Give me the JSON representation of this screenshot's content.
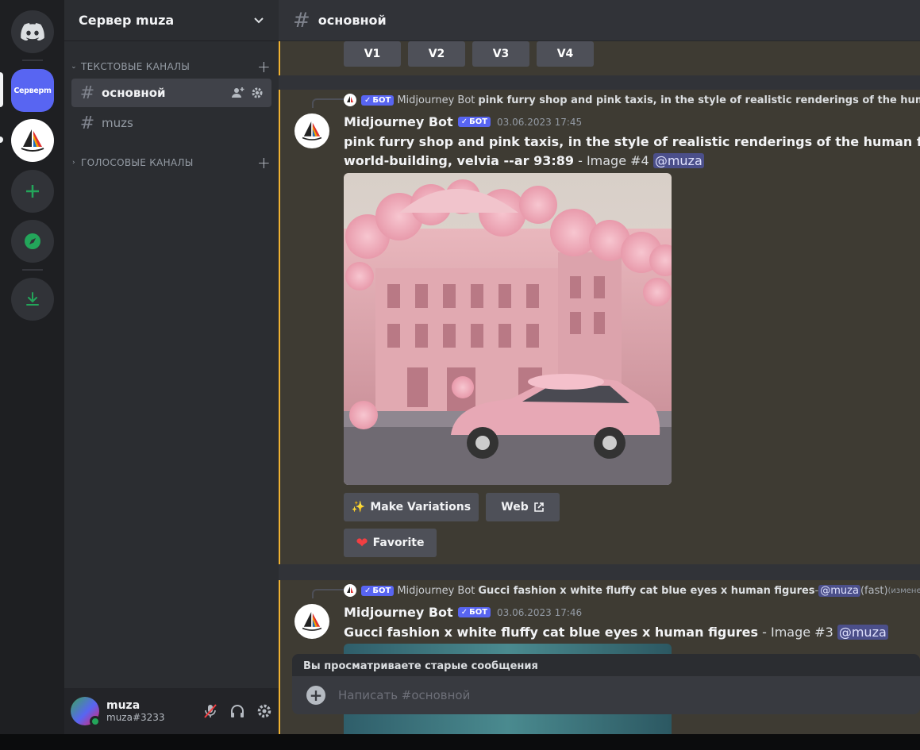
{
  "rail": {
    "current_server_label": "Серверm"
  },
  "sidebar": {
    "server_name": "Сервер muza",
    "text_category": "ТЕКСТОВЫЕ КАНАЛЫ",
    "voice_category": "ГОЛОСОВЫЕ КАНАЛЫ",
    "channels": [
      {
        "name": "основной"
      },
      {
        "name": "muzs"
      }
    ]
  },
  "user": {
    "name": "muza",
    "tag": "muza#3233"
  },
  "header": {
    "channel": "основной"
  },
  "prev_message": {
    "buttons": [
      "V1",
      "V2",
      "V3",
      "V4"
    ]
  },
  "message1": {
    "reply_author": "Midjourney Bot",
    "reply_text": "pink furry shop and pink taxis, in the style of realistic renderings of the human",
    "author": "Midjourney Bot",
    "badge": "БОТ",
    "timestamp": "03.06.2023 17:45",
    "prompt_line1": "pink furry shop and pink taxis, in the style of realistic renderings of the human form, mesm",
    "prompt_line2": "world-building, velvia --ar 93:89",
    "image_suffix": " - Image #4 ",
    "mention": "@muza",
    "btn_variations": "Make Variations",
    "btn_web": "Web",
    "btn_favorite": "Favorite"
  },
  "message2": {
    "reply_author": "Midjourney Bot",
    "reply_text": "Gucci fashion x white fluffy cat blue eyes x human figures",
    "reply_dash": " - ",
    "reply_mention": "@muza",
    "reply_fast": " (fast)",
    "reply_edited": " (изменено)",
    "author": "Midjourney Bot",
    "badge": "БОТ",
    "timestamp": "03.06.2023 17:46",
    "prompt": "Gucci fashion x white fluffy cat blue eyes x human figures",
    "image_suffix": " - Image #3 ",
    "mention": "@muza"
  },
  "composer": {
    "old_messages_banner": "Вы просматриваете старые сообщения",
    "placeholder": "Написать #основной"
  }
}
